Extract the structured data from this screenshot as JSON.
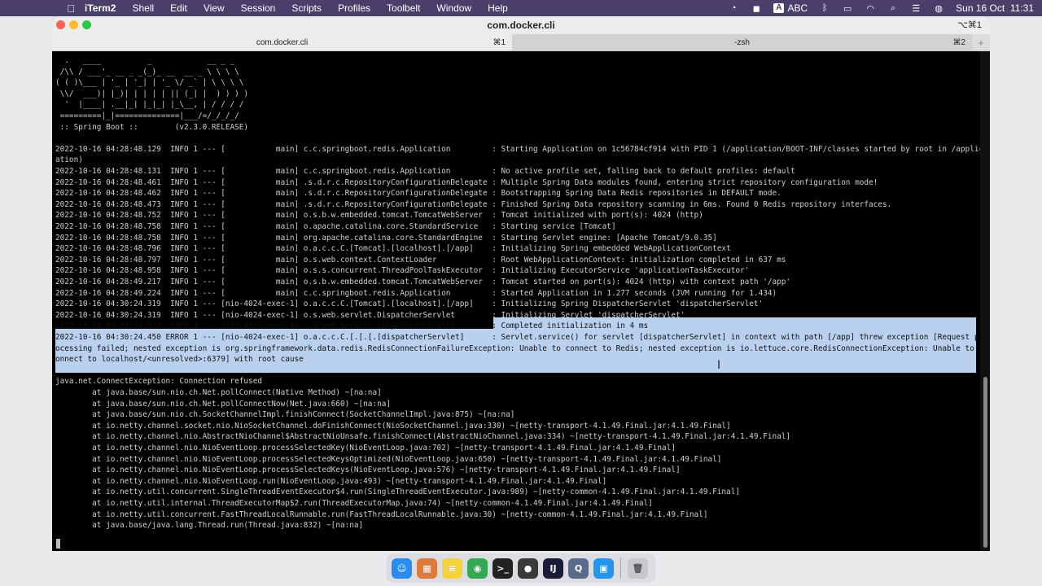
{
  "menubar": {
    "app_name": "iTerm2",
    "items": [
      "Shell",
      "Edit",
      "View",
      "Session",
      "Scripts",
      "Profiles",
      "Toolbelt",
      "Window",
      "Help"
    ],
    "input_source": "ABC",
    "clock": "Sun 16 Oct  11:31"
  },
  "window": {
    "title": "com.docker.cli",
    "title_shortcut": "⌥⌘1",
    "tabs": [
      {
        "label": "com.docker.cli",
        "shortcut": "⌘1"
      },
      {
        "label": "-zsh",
        "shortcut": "⌘2"
      }
    ],
    "add_tab": "+"
  },
  "terminal": {
    "lines": [
      "  .   ____          _            __ _ _",
      " /\\\\ / ___'_ __ _ _(_)_ __  __ _ \\ \\ \\ \\",
      "( ( )\\___ | '_ | '_| | '_ \\/ _` | \\ \\ \\ \\",
      " \\\\/  ___)| |_)| | | | | || (_| |  ) ) ) )",
      "  '  |____| .__|_| |_|_| |_\\__, | / / / /",
      " =========|_|==============|___/=/_/_/_/",
      " :: Spring Boot ::        (v2.3.0.RELEASE)",
      "",
      "2022-10-16 04:28:48.129  INFO 1 --- [           main] c.c.springboot.redis.Application         : Starting Application on 1c56784cf914 with PID 1 (/application/BOOT-INF/classes started by root in /applic",
      "ation)",
      "2022-10-16 04:28:48.131  INFO 1 --- [           main] c.c.springboot.redis.Application         : No active profile set, falling back to default profiles: default",
      "2022-10-16 04:28:48.461  INFO 1 --- [           main] .s.d.r.c.RepositoryConfigurationDelegate : Multiple Spring Data modules found, entering strict repository configuration mode!",
      "2022-10-16 04:28:48.462  INFO 1 --- [           main] .s.d.r.c.RepositoryConfigurationDelegate : Bootstrapping Spring Data Redis repositories in DEFAULT mode.",
      "2022-10-16 04:28:48.473  INFO 1 --- [           main] .s.d.r.c.RepositoryConfigurationDelegate : Finished Spring Data repository scanning in 6ms. Found 0 Redis repository interfaces.",
      "2022-10-16 04:28:48.752  INFO 1 --- [           main] o.s.b.w.embedded.tomcat.TomcatWebServer  : Tomcat initialized with port(s): 4024 (http)",
      "2022-10-16 04:28:48.758  INFO 1 --- [           main] o.apache.catalina.core.StandardService   : Starting service [Tomcat]",
      "2022-10-16 04:28:48.758  INFO 1 --- [           main] org.apache.catalina.core.StandardEngine  : Starting Servlet engine: [Apache Tomcat/9.0.35]",
      "2022-10-16 04:28:48.796  INFO 1 --- [           main] o.a.c.c.C.[Tomcat].[localhost].[/app]    : Initializing Spring embedded WebApplicationContext",
      "2022-10-16 04:28:48.797  INFO 1 --- [           main] o.s.web.context.ContextLoader            : Root WebApplicationContext: initialization completed in 637 ms",
      "2022-10-16 04:28:48.958  INFO 1 --- [           main] o.s.s.concurrent.ThreadPoolTaskExecutor  : Initializing ExecutorService 'applicationTaskExecutor'",
      "2022-10-16 04:28:49.217  INFO 1 --- [           main] o.s.b.w.embedded.tomcat.TomcatWebServer  : Tomcat started on port(s): 4024 (http) with context path '/app'",
      "2022-10-16 04:28:49.224  INFO 1 --- [           main] c.c.springboot.redis.Application         : Started Application in 1.277 seconds (JVM running for 1.434)",
      "2022-10-16 04:30:24.319  INFO 1 --- [nio-4024-exec-1] o.a.c.c.C.[Tomcat].[localhost].[/app]    : Initializing Spring DispatcherServlet 'dispatcherServlet'",
      "2022-10-16 04:30:24.319  INFO 1 --- [nio-4024-exec-1] o.s.web.servlet.DispatcherServlet        : Initializing Servlet 'dispatcherServlet'",
      "2022-10-16 04:30:24.323  INFO 1 --- [nio-4024-exec-1] o.s.web.servlet.DispatcherServlet        : Completed initialization in 4 ms",
      "2022-10-16 04:30:24.450 ERROR 1 --- [nio-4024-exec-1] o.a.c.c.C.[.[.[.[dispatcherServlet]      : Servlet.service() for servlet [dispatcherServlet] in context with path [/app] threw exception [Request pr",
      "ocessing failed; nested exception is org.springframework.data.redis.RedisConnectionFailureException: Unable to connect to Redis; nested exception is io.lettuce.core.RedisConnectionException: Unable to c",
      "onnect to localhost/<unresolved>:6379] with root cause",
      "",
      "java.net.ConnectException: Connection refused",
      "        at java.base/sun.nio.ch.Net.pollConnect(Native Method) ~[na:na]",
      "        at java.base/sun.nio.ch.Net.pollConnectNow(Net.java:660) ~[na:na]",
      "        at java.base/sun.nio.ch.SocketChannelImpl.finishConnect(SocketChannelImpl.java:875) ~[na:na]",
      "        at io.netty.channel.socket.nio.NioSocketChannel.doFinishConnect(NioSocketChannel.java:330) ~[netty-transport-4.1.49.Final.jar:4.1.49.Final]",
      "        at io.netty.channel.nio.AbstractNioChannel$AbstractNioUnsafe.finishConnect(AbstractNioChannel.java:334) ~[netty-transport-4.1.49.Final.jar:4.1.49.Final]",
      "        at io.netty.channel.nio.NioEventLoop.processSelectedKey(NioEventLoop.java:702) ~[netty-transport-4.1.49.Final.jar:4.1.49.Final]",
      "        at io.netty.channel.nio.NioEventLoop.processSelectedKeysOptimized(NioEventLoop.java:650) ~[netty-transport-4.1.49.Final.jar:4.1.49.Final]",
      "        at io.netty.channel.nio.NioEventLoop.processSelectedKeys(NioEventLoop.java:576) ~[netty-transport-4.1.49.Final.jar:4.1.49.Final]",
      "        at io.netty.channel.nio.NioEventLoop.run(NioEventLoop.java:493) ~[netty-transport-4.1.49.Final.jar:4.1.49.Final]",
      "        at io.netty.util.concurrent.SingleThreadEventExecutor$4.run(SingleThreadEventExecutor.java:989) ~[netty-common-4.1.49.Final.jar:4.1.49.Final]",
      "        at io.netty.util.internal.ThreadExecutorMap$2.run(ThreadExecutorMap.java:74) ~[netty-common-4.1.49.Final.jar:4.1.49.Final]",
      "        at io.netty.util.concurrent.FastThreadLocalRunnable.run(FastThreadLocalRunnable.java:30) ~[netty-common-4.1.49.Final.jar:4.1.49.Final]",
      "        at java.base/java.lang.Thread.run(Thread.java:832) ~[na:na]"
    ],
    "selected_lines": [
      24,
      25,
      26,
      27
    ]
  },
  "dock": {
    "apps": [
      {
        "icon": "finder-icon",
        "glyph": "☺",
        "color": "#2a8cf0"
      },
      {
        "icon": "launchpad-icon",
        "glyph": "▦",
        "color": "#e07a3a"
      },
      {
        "icon": "notes-icon",
        "glyph": "≡",
        "color": "#f5d33a"
      },
      {
        "icon": "chrome-icon",
        "glyph": "◉",
        "color": "#34a853"
      },
      {
        "icon": "terminal-icon",
        "glyph": ">_",
        "color": "#222222"
      },
      {
        "icon": "github-icon",
        "glyph": "●",
        "color": "#3a3a3a"
      },
      {
        "icon": "intellij-icon",
        "glyph": "IJ",
        "color": "#1b1b3a"
      },
      {
        "icon": "quicktime-icon",
        "glyph": "Q",
        "color": "#5a6b8a"
      },
      {
        "icon": "docker-icon",
        "glyph": "▣",
        "color": "#2496ed"
      }
    ],
    "trash": {
      "icon": "trash-icon",
      "glyph": "🗑",
      "color": "#c8c8cc"
    }
  }
}
